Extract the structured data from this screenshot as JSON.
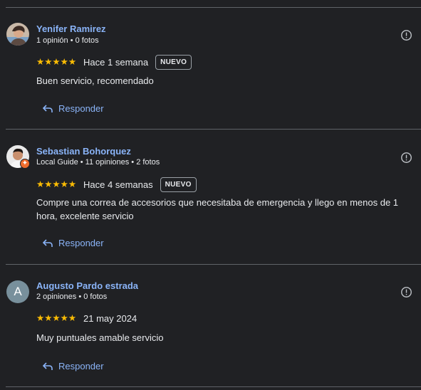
{
  "reviews": [
    {
      "name": "Yenifer Ramirez",
      "meta": "1 opinión • 0 fotos",
      "stars": "★★★★★",
      "rating": 5,
      "date": "Hace 1 semana",
      "badge": "NUEVO",
      "text": "Buen servicio, recomendado",
      "reply": "Responder",
      "avatar_icon": "person-photo-icon"
    },
    {
      "name": "Sebastian Bohorquez",
      "meta": "Local Guide • 11 opiniones • 2 fotos",
      "stars": "★★★★★",
      "rating": 5,
      "date": "Hace 4 semanas",
      "badge": "NUEVO",
      "text": "Compre una correa de accesorios que necesitaba de emergencia y llego en menos de 1 hora, excelente servicio",
      "reply": "Responder",
      "avatar_icon": "person-photo-icon"
    },
    {
      "name": "Augusto Pardo estrada",
      "meta": "2 opiniones • 0 fotos",
      "stars": "★★★★★",
      "rating": 5,
      "date": "21 may 2024",
      "avatar_letter": "A",
      "text": "Muy puntuales amable servicio",
      "reply": "Responder"
    }
  ],
  "colors": {
    "background": "#202124",
    "link": "#8ab4f8",
    "star": "#fbbc04",
    "divider": "#5f6368",
    "letter_avatar": "#78909c",
    "guide_badge": "#ee6c2d"
  },
  "icons": {
    "flag": "report-flag-icon",
    "reply": "reply-arrow-icon",
    "guide": "local-guide-badge-icon"
  }
}
